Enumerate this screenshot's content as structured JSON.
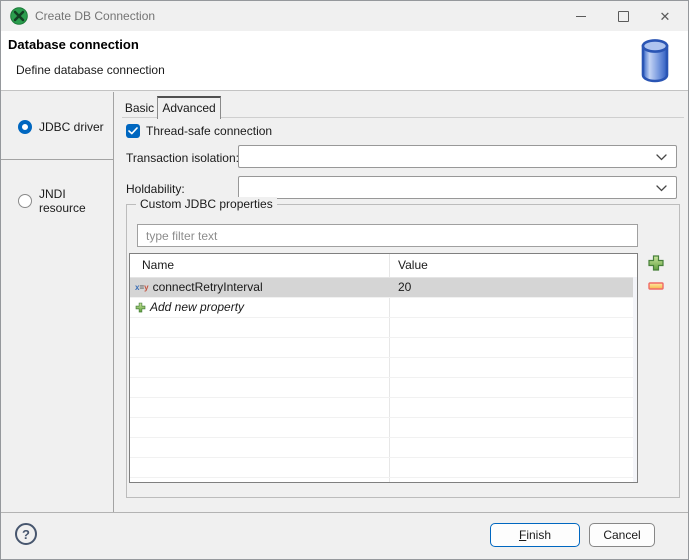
{
  "window": {
    "title": "Create DB Connection"
  },
  "titlebar_icons": {
    "app_logo": "green-clover-circle",
    "minimize": "minimize-bar",
    "maximize": "maximize-square",
    "close": "✕"
  },
  "header": {
    "title": "Database connection",
    "subtitle": "Define database connection",
    "icon": "database-cylinder"
  },
  "sidebar": {
    "options": [
      {
        "label": "JDBC driver",
        "selected": true
      },
      {
        "label": "JNDI resource",
        "selected": false
      }
    ]
  },
  "tabs": [
    {
      "label": "Basic",
      "selected": false
    },
    {
      "label": "Advanced",
      "selected": true
    }
  ],
  "advanced": {
    "thread_safe": {
      "label": "Thread-safe connection",
      "checked": true
    },
    "fields": [
      {
        "label": "Transaction isolation:",
        "value": ""
      },
      {
        "label": "Holdability:",
        "value": ""
      }
    ],
    "group": {
      "title": "Custom JDBC properties",
      "filter_placeholder": "type filter text",
      "table": {
        "columns": [
          "Name",
          "Value"
        ],
        "rows": [
          {
            "name": "connectRetryInterval",
            "value": "20",
            "selected": true,
            "icon": "variable-xy"
          },
          {
            "name": "Add new property",
            "value": "",
            "selected": false,
            "icon": "add-plus",
            "italic": true
          }
        ],
        "empty_row_count": 9
      },
      "buttons": {
        "add": "add-plus",
        "remove": "remove-minus"
      }
    }
  },
  "footer": {
    "help": "?",
    "finish_label": "Finish",
    "cancel_label": "Cancel"
  },
  "colors": {
    "accent": "#0067c0",
    "selected_row": "#d5d5d5",
    "add_green": "#5d9e3c",
    "remove_red": "#ef6a66",
    "logo_green": "#2b9e4e",
    "db_blue": "#2c64c8"
  }
}
